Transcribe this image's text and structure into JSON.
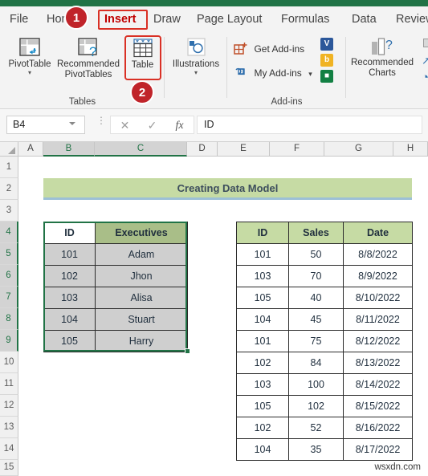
{
  "window": {
    "accent_green": "#217346"
  },
  "ribbon": {
    "tabs": [
      {
        "label": "File",
        "active": false
      },
      {
        "label": "Home",
        "active": false
      },
      {
        "label": "Insert",
        "active": true
      },
      {
        "label": "Draw",
        "active": false
      },
      {
        "label": "Page Layout",
        "active": false
      },
      {
        "label": "Formulas",
        "active": false
      },
      {
        "label": "Data",
        "active": false
      },
      {
        "label": "Review",
        "active": false
      }
    ],
    "groups": [
      {
        "name": "Tables",
        "label": "Tables"
      },
      {
        "name": "Illustrations",
        "label": ""
      },
      {
        "name": "Add-ins",
        "label": "Add-ins"
      },
      {
        "name": "Charts",
        "label": ""
      }
    ],
    "buttons": {
      "pivot_table": "PivotTable",
      "recommended_pivot_tables": "Recommended\nPivotTables",
      "table": "Table",
      "illustrations": "Illustrations",
      "get_add_ins": "Get Add-ins",
      "my_add_ins": "My Add-ins",
      "recommended_charts": "Recommended\nCharts"
    },
    "callouts": [
      {
        "number": "1",
        "target": "insert-tab"
      },
      {
        "number": "2",
        "target": "table-button"
      }
    ]
  },
  "formula_bar": {
    "name_box_value": "B4",
    "cancel_icon": "✕",
    "enter_icon": "✓",
    "function_icon": "fx",
    "content": "ID"
  },
  "grid": {
    "column_headers": [
      "A",
      "B",
      "C",
      "D",
      "E",
      "F",
      "G",
      "H"
    ],
    "selected_columns": [
      "B",
      "C"
    ],
    "row_headers": [
      "1",
      "2",
      "3",
      "4",
      "5",
      "6",
      "7",
      "8",
      "9",
      "10",
      "11",
      "12",
      "13",
      "14",
      "15"
    ],
    "selected_rows": [
      "4",
      "5",
      "6",
      "7",
      "8",
      "9"
    ],
    "banner_text": "Creating Data Model",
    "banner_fill": "#c6dba4",
    "banner_underline": "#9cc0d6"
  },
  "left_table": {
    "name": "executives-table",
    "selected": true,
    "active_cell": "B4",
    "headers": [
      "ID",
      "Executives"
    ],
    "rows": [
      [
        "101",
        "Adam"
      ],
      [
        "102",
        "Jhon"
      ],
      [
        "103",
        "Alisa"
      ],
      [
        "104",
        "Stuart"
      ],
      [
        "105",
        "Harry"
      ]
    ]
  },
  "right_table": {
    "name": "sales-table",
    "selected": false,
    "headers": [
      "ID",
      "Sales",
      "Date"
    ],
    "rows": [
      [
        "101",
        "50",
        "8/8/2022"
      ],
      [
        "103",
        "70",
        "8/9/2022"
      ],
      [
        "105",
        "40",
        "8/10/2022"
      ],
      [
        "104",
        "45",
        "8/11/2022"
      ],
      [
        "101",
        "75",
        "8/12/2022"
      ],
      [
        "102",
        "84",
        "8/13/2022"
      ],
      [
        "103",
        "100",
        "8/14/2022"
      ],
      [
        "105",
        "102",
        "8/15/2022"
      ],
      [
        "102",
        "52",
        "8/16/2022"
      ],
      [
        "104",
        "35",
        "8/17/2022"
      ]
    ]
  },
  "watermark": {
    "text": "wsxdn.com"
  }
}
